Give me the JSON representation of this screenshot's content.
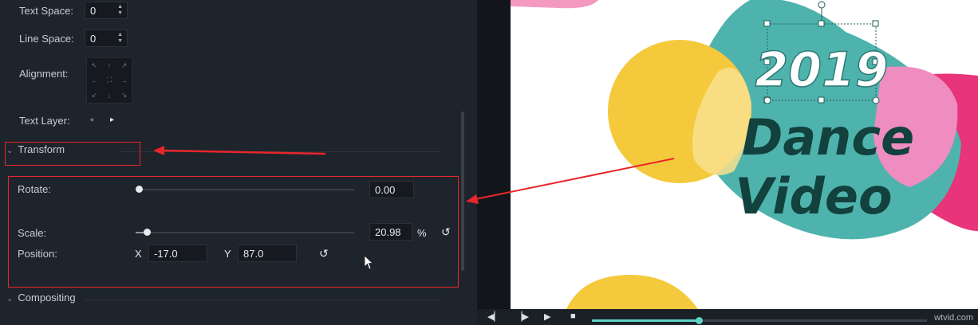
{
  "text_props": {
    "text_space_label": "Text Space:",
    "text_space_value": "0",
    "line_space_label": "Line Space:",
    "line_space_value": "0",
    "alignment_label": "Alignment:",
    "text_layer_label": "Text Layer:"
  },
  "sections": {
    "transform": "Transform",
    "compositing": "Compositing"
  },
  "transform": {
    "rotate_label": "Rotate:",
    "rotate_value": "0.00",
    "rotate_level": 0.0,
    "scale_label": "Scale:",
    "scale_value": "20.98",
    "scale_unit": "%",
    "scale_level": 0.05,
    "position_label": "Position:",
    "x_label": "X",
    "x_value": "-17.0",
    "y_label": "Y",
    "y_value": "87.0"
  },
  "preview": {
    "year": "2019",
    "line1": "Dance",
    "line2": "Video"
  },
  "playback": {
    "progress": 0.32
  },
  "watermark": "wtvid.com",
  "colors": {
    "annotation_red": "#e8262b",
    "teal": "#4fb3ad",
    "yellow": "#f5c93c",
    "pink": "#e8457f",
    "timeline_accent": "#5fd3c8"
  },
  "icons": [
    "chevron-down-icon",
    "reset-icon",
    "spin-arrows-icon",
    "align-grid-icon",
    "prev-frame-icon",
    "play-icon",
    "stop-icon",
    "cursor-icon"
  ]
}
